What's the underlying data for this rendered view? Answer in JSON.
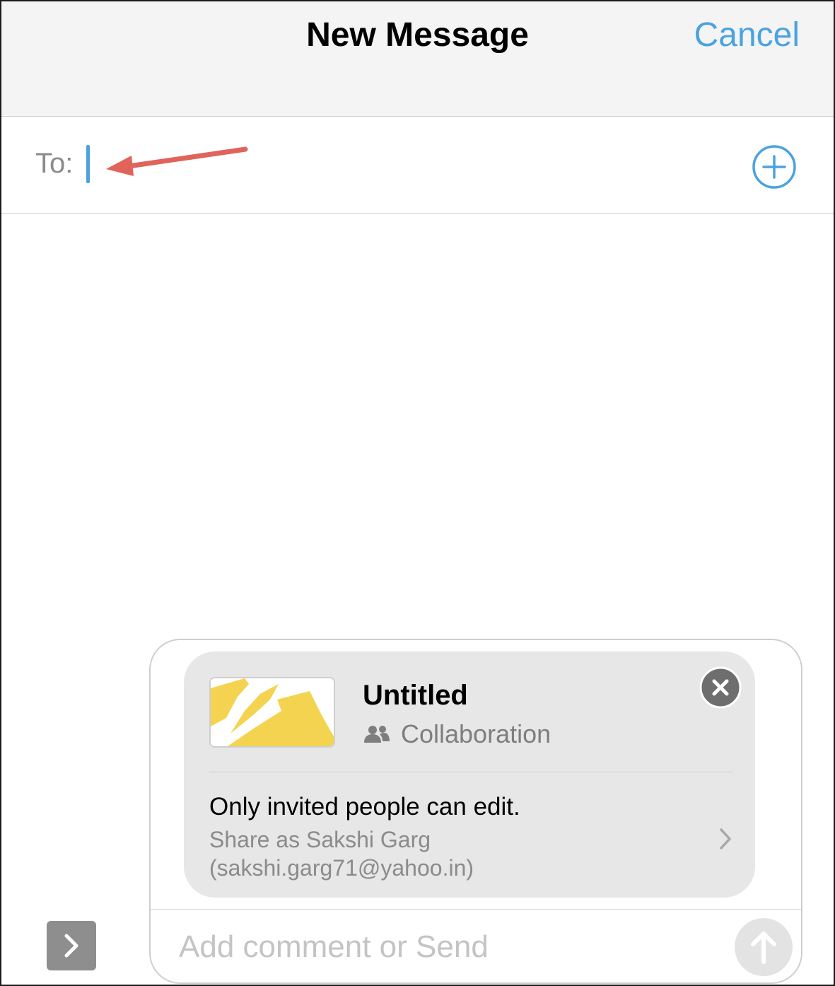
{
  "header": {
    "title": "New Message",
    "cancel_label": "Cancel"
  },
  "recipient": {
    "label": "To:",
    "value": "",
    "add_icon": "plus-circle-icon"
  },
  "attachment": {
    "title": "Untitled",
    "type_label": "Collaboration",
    "type_icon": "people-icon",
    "permission": "Only invited people can edit.",
    "share_as_line1": "Share as Sakshi Garg",
    "share_as_line2": "(sakshi.garg71@yahoo.in)",
    "close_icon": "close-icon",
    "chevron_icon": "chevron-right-icon"
  },
  "composer": {
    "placeholder": "Add comment or Send",
    "send_icon": "arrow-up-icon",
    "expand_icon": "chevron-right-icon"
  },
  "colors": {
    "accent": "#4aa3e0",
    "annotation_arrow": "#e0645a",
    "thumbnail_yellow": "#f4d350"
  }
}
